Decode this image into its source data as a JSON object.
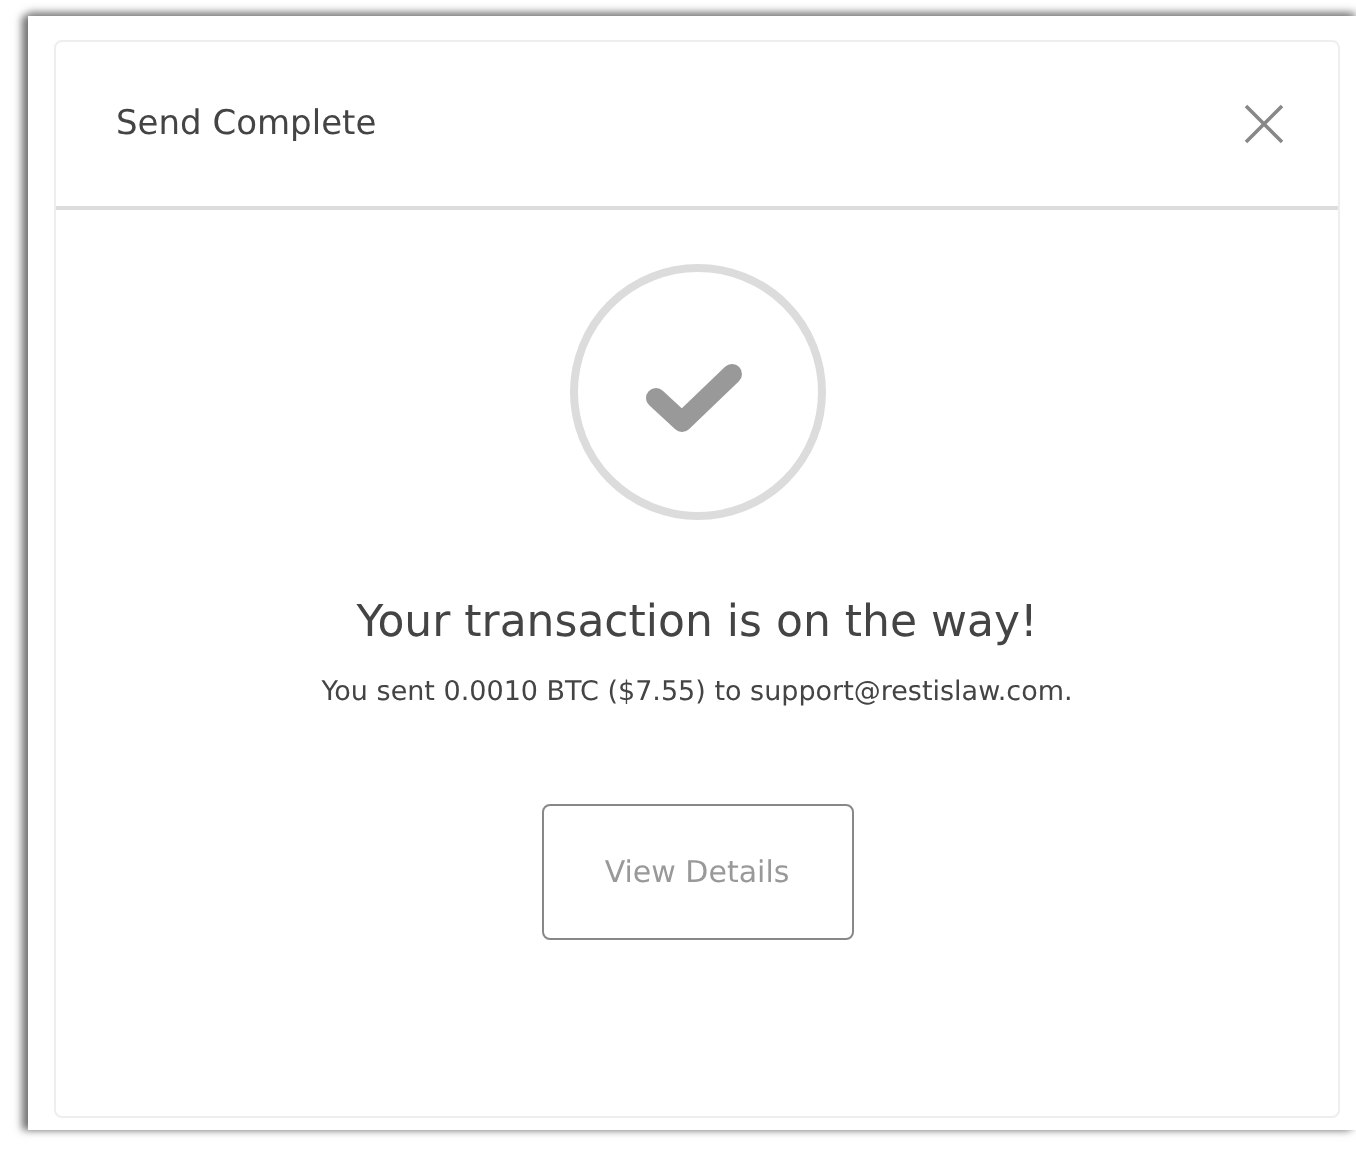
{
  "dialog": {
    "title": "Send Complete",
    "heading": "Your transaction is on the way!",
    "message": "You sent 0.0010 BTC ($7.55) to support@restislaw.com.",
    "button": "View Details"
  }
}
